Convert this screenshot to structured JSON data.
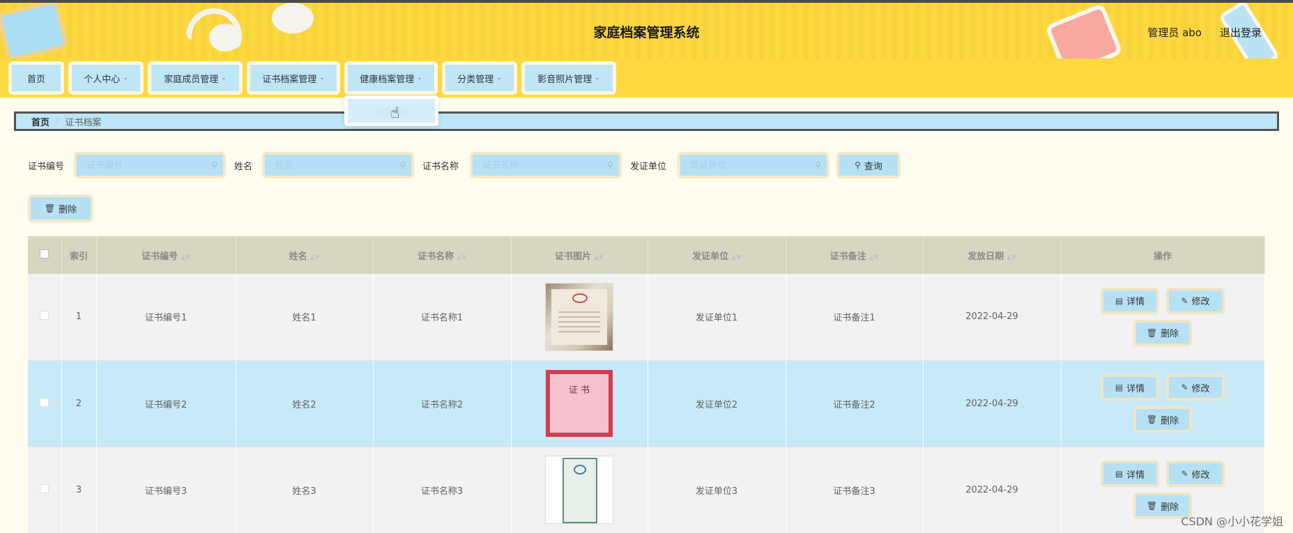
{
  "header": {
    "title": "家庭档案管理系统",
    "admin": "管理员 abo",
    "logout": "退出登录"
  },
  "nav": [
    {
      "label": "首页",
      "has_dropdown": false
    },
    {
      "label": "个人中心",
      "has_dropdown": true
    },
    {
      "label": "家庭成员管理",
      "has_dropdown": true
    },
    {
      "label": "证书档案管理",
      "has_dropdown": true
    },
    {
      "label": "健康档案管理",
      "has_dropdown": true
    },
    {
      "label": "分类管理",
      "has_dropdown": true
    },
    {
      "label": "影音照片管理",
      "has_dropdown": true
    }
  ],
  "dropdown": {
    "item": "健康档案"
  },
  "breadcrumb": {
    "home": "首页",
    "separator": "/",
    "current": "证书档案"
  },
  "search": {
    "fields": [
      {
        "label": "证书编号",
        "placeholder": "证书编号"
      },
      {
        "label": "姓名",
        "placeholder": "姓名"
      },
      {
        "label": "证书名称",
        "placeholder": "证书名称"
      },
      {
        "label": "发证单位",
        "placeholder": "发证单位"
      }
    ],
    "query_label": "查询"
  },
  "toolbar": {
    "delete_label": "删除"
  },
  "table": {
    "columns": [
      "索引",
      "证书编号",
      "姓名",
      "证书名称",
      "证书图片",
      "发证单位",
      "证书备注",
      "发放日期",
      "操作"
    ],
    "rows": [
      {
        "index": "1",
        "cert_no": "证书编号1",
        "name": "姓名1",
        "cert_name": "证书名称1",
        "issuer": "发证单位1",
        "remark": "证书备注1",
        "date": "2022-04-29"
      },
      {
        "index": "2",
        "cert_no": "证书编号2",
        "name": "姓名2",
        "cert_name": "证书名称2",
        "issuer": "发证单位2",
        "remark": "证书备注2",
        "date": "2022-04-29"
      },
      {
        "index": "3",
        "cert_no": "证书编号3",
        "name": "姓名3",
        "cert_name": "证书名称3",
        "issuer": "发证单位3",
        "remark": "证书备注3",
        "date": "2022-04-29"
      }
    ],
    "actions": {
      "detail": "详情",
      "edit": "修改",
      "delete": "删除"
    },
    "thumb2_text": "证 书"
  },
  "watermark": "CSDN @小小花学姐",
  "colors": {
    "header_bg": "#fdd93f",
    "button_bg": "#b6e1f5",
    "row_highlight": "#c7e9f8"
  }
}
